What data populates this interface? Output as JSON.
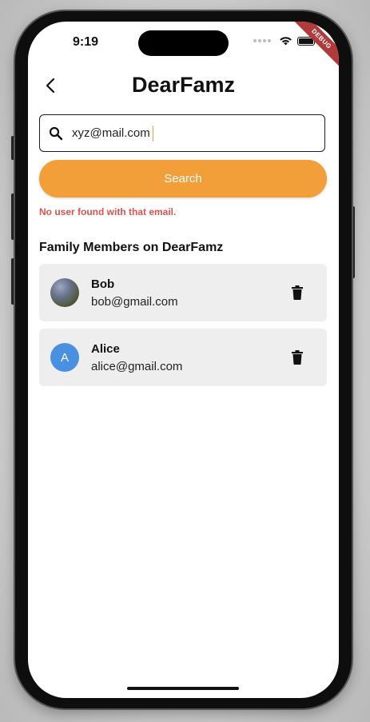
{
  "status_bar": {
    "time": "9:19",
    "debug_label": "DEBUG"
  },
  "app_bar": {
    "title": "DearFamz",
    "back_icon": "chevron-left-icon"
  },
  "search": {
    "value": "xyz@mail.com",
    "icon": "search-icon",
    "button_label": "Search",
    "error": "No user found with that email."
  },
  "section": {
    "title": "Family Members on DearFamz"
  },
  "members": [
    {
      "name": "Bob",
      "email": "bob@gmail.com",
      "avatar": "photo"
    },
    {
      "name": "Alice",
      "email": "alice@gmail.com",
      "avatar": "initial",
      "initial": "A"
    }
  ],
  "colors": {
    "accent": "#f29e39",
    "error": "#d9534f",
    "avatar_blue": "#4a90e2",
    "card_bg": "#eeeeee"
  }
}
